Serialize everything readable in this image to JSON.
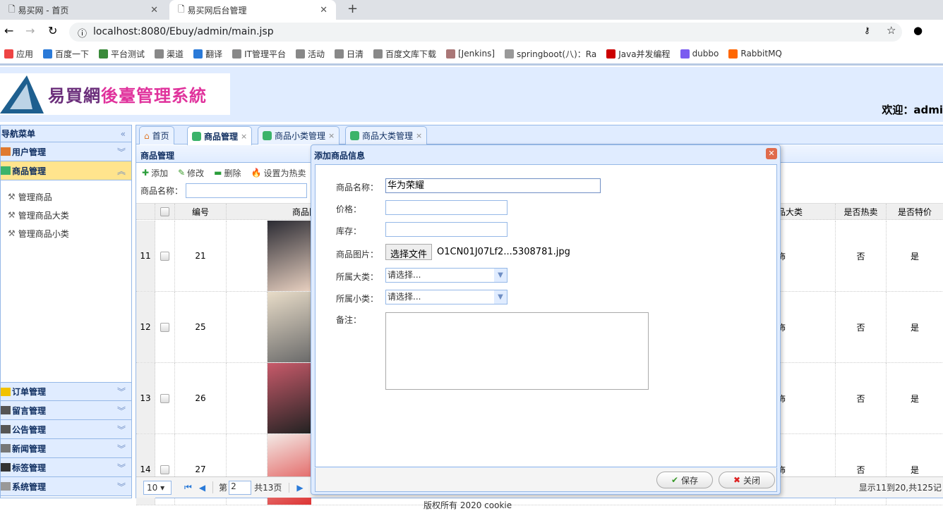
{
  "browser": {
    "tabs": [
      {
        "title": "易买网 - 首页"
      },
      {
        "title": "易买网后台管理"
      }
    ],
    "url": "localhost:8080/Ebuy/admin/main.jsp",
    "bookmarks": [
      "应用",
      "百度一下",
      "平台测试",
      "渠道",
      "翻译",
      "IT管理平台",
      "活动",
      "日清",
      "百度文库下载",
      "[Jenkins]",
      "springboot(八)：Ra",
      "Java并发编程",
      "dubbo",
      "RabbitMQ"
    ]
  },
  "header": {
    "logo_a": "易買網",
    "logo_b": "後臺管理系統",
    "welcome": "欢迎：admi"
  },
  "sidebar": {
    "title": "导航菜单",
    "groups": [
      {
        "label": "用户管理",
        "color": "#e07a2f"
      },
      {
        "label": "商品管理",
        "color": "#3bb36a"
      }
    ],
    "sub_items": [
      "管理商品",
      "管理商品大类",
      "管理商品小类"
    ],
    "bottom_groups": [
      {
        "label": "订单管理",
        "color": "#f2c200"
      },
      {
        "label": "留言管理",
        "color": "#555"
      },
      {
        "label": "公告管理",
        "color": "#555"
      },
      {
        "label": "新闻管理",
        "color": "#777"
      },
      {
        "label": "标签管理",
        "color": "#333"
      },
      {
        "label": "系统管理",
        "color": "#999"
      }
    ]
  },
  "tabs": [
    "首页",
    "商品管理",
    "商品小类管理",
    "商品大类管理"
  ],
  "panel": {
    "title": "商品管理",
    "toolbar": [
      "添加",
      "修改",
      "删除",
      "设置为热卖"
    ],
    "search_label": "商品名称："
  },
  "table": {
    "headers": {
      "id": "编号",
      "image": "商品图",
      "category": "品大类",
      "hot": "是否热卖",
      "special": "是否特价"
    },
    "rows": [
      {
        "n": "11",
        "id": "21",
        "category": "饰",
        "hot": "否",
        "special": "是"
      },
      {
        "n": "12",
        "id": "25",
        "category": "饰",
        "hot": "否",
        "special": "是"
      },
      {
        "n": "13",
        "id": "26",
        "category": "饰",
        "hot": "否",
        "special": "是"
      },
      {
        "n": "14",
        "id": "27",
        "category": "饰",
        "hot": "否",
        "special": "是"
      }
    ]
  },
  "pager": {
    "page_size": "10 ▾",
    "page_prefix": "第",
    "page": "2",
    "total_pages": "共13页",
    "info": "显示11到20,共125记"
  },
  "dialog": {
    "title": "添加商品信息",
    "fields": {
      "name_label": "商品名称：",
      "name_value": "华为荣耀",
      "price_label": "价格：",
      "stock_label": "库存：",
      "image_label": "商品图片：",
      "file_button": "选择文件",
      "file_name": "O1CN01J07Lf2...5308781.jpg",
      "big_label": "所属大类：",
      "big_value": "请选择...",
      "small_label": "所属小类：",
      "small_value": "请选择...",
      "remark_label": "备注："
    },
    "save": "保存",
    "close": "关闭"
  },
  "footer": "版权所有 2020 cookie"
}
